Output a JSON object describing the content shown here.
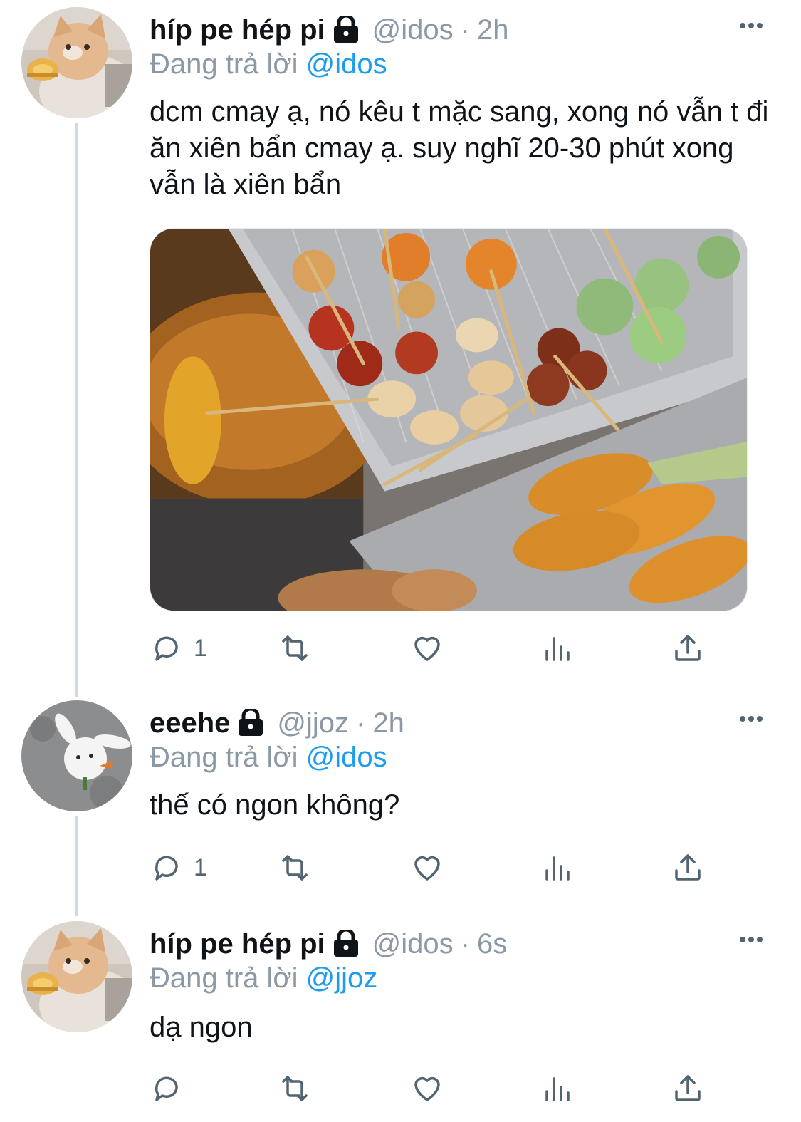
{
  "colors": {
    "accent": "#1d9bf0",
    "muted": "#8b98a5",
    "text": "#0f1419",
    "thread": "#cfd9de"
  },
  "tweets": [
    {
      "name": "híp pe hép pi",
      "handle": "@idos",
      "separator": "·",
      "time": "2h",
      "reply_prefix": "Đang trả lời ",
      "reply_mention": "@idos",
      "text": "dcm cmay ạ, nó kêu t mặc sang, xong nó vẫn t đi ăn xiên bẩn cmay ạ. suy nghĩ 20-30 phút xong vẫn là xiên bẩn",
      "reply_count": "1",
      "avatar": "cat-avatar",
      "media": "fried-skewers-photo"
    },
    {
      "name": "eeehe",
      "handle": "@jjoz",
      "separator": "·",
      "time": "2h",
      "reply_prefix": "Đang trả lời ",
      "reply_mention": "@idos",
      "text": "thế có ngon không?",
      "reply_count": "1",
      "avatar": "bunny-avatar"
    },
    {
      "name": "híp pe hép pi",
      "handle": "@idos",
      "separator": "·",
      "time": "6s",
      "reply_prefix": "Đang trả lời ",
      "reply_mention": "@jjoz",
      "text": "dạ ngon",
      "reply_count": "",
      "avatar": "cat-avatar"
    }
  ]
}
